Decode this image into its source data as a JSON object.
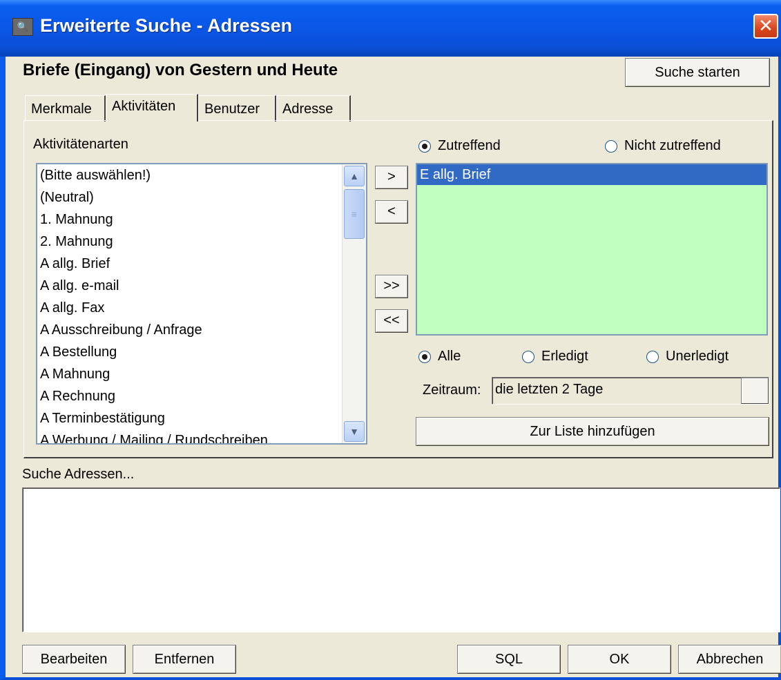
{
  "window": {
    "title": "Erweiterte Suche - Adressen",
    "icon_text": "🔍",
    "close_symbol": "✕"
  },
  "heading": "Briefe (Eingang) von Gestern und Heute",
  "start_search_label": "Suche starten",
  "tabs": [
    {
      "label": "Merkmale",
      "active": false
    },
    {
      "label": "Aktivitäten",
      "active": true
    },
    {
      "label": "Benutzer",
      "active": false
    },
    {
      "label": "Adresse",
      "active": false
    }
  ],
  "activities": {
    "label": "Aktivitätenarten",
    "items": [
      "(Bitte auswählen!)",
      "(Neutral)",
      "1. Mahnung",
      "2. Mahnung",
      "A allg. Brief",
      "A allg. e-mail",
      "A allg. Fax",
      "A Ausschreibung / Anfrage",
      "A Bestellung",
      "A Mahnung",
      "A Rechnung",
      "A Terminbestätigung",
      "A Werbung / Mailing / Rundschreiben"
    ]
  },
  "move_buttons": {
    "add": ">",
    "remove": "<",
    "add_all": ">>",
    "remove_all": "<<"
  },
  "match": {
    "zutreffend": "Zutreffend",
    "nicht_zutreffend": "Nicht zutreffend",
    "selected": "zutreffend"
  },
  "selected_items": [
    "E allg. Brief"
  ],
  "status": {
    "alle": "Alle",
    "erledigt": "Erledigt",
    "unerledigt": "Unerledigt",
    "selected": "alle"
  },
  "period": {
    "label": "Zeitraum:",
    "value": "die letzten 2 Tage"
  },
  "add_to_list_label": "Zur Liste hinzufügen",
  "results": {
    "label": "Suche Adressen..."
  },
  "footer": {
    "edit": "Bearbeiten",
    "remove": "Entfernen",
    "sql": "SQL",
    "ok": "OK",
    "cancel": "Abbrechen"
  }
}
